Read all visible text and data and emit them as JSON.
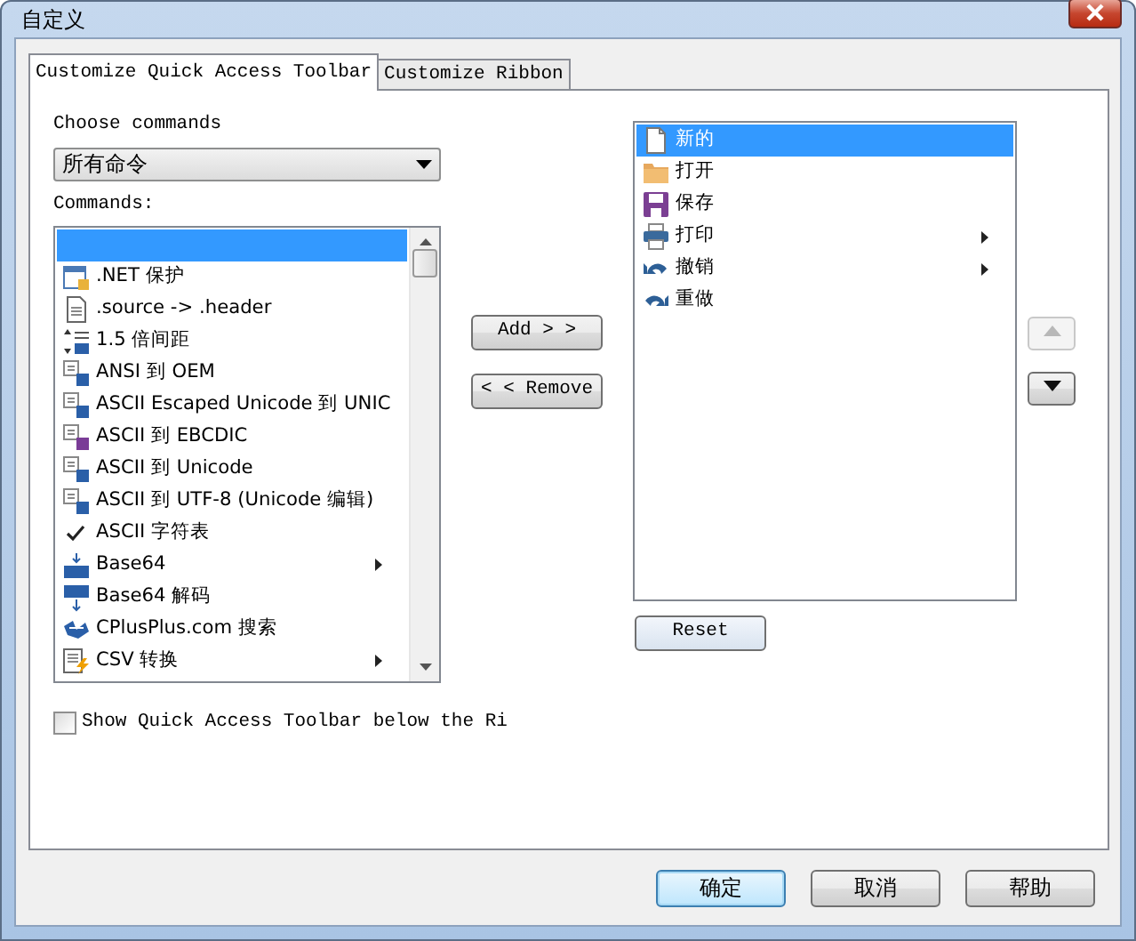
{
  "window": {
    "title": "自定义"
  },
  "tabs": [
    {
      "label": "Customize Quick Access Toolbar",
      "selected": true
    },
    {
      "label": "Customize Ribbon",
      "selected": false
    }
  ],
  "choose_label": "Choose commands",
  "command_dropdown": {
    "value": "所有命令"
  },
  "commands_label": "Commands:",
  "commands": [
    {
      "selected": true,
      "checked": false,
      "has_submenu": false
    },
    {
      "label": ".NET 保护",
      "selected": false,
      "checked": false,
      "has_submenu": false
    },
    {
      "label": ".source -> .header",
      "selected": false,
      "checked": false,
      "has_submenu": false
    },
    {
      "label": "1.5 倍间距",
      "selected": false,
      "checked": false,
      "has_submenu": false
    },
    {
      "label": "ANSI 到 OEM",
      "selected": false,
      "checked": false,
      "has_submenu": false
    },
    {
      "label": "ASCII Escaped Unicode 到 UNIC",
      "selected": false,
      "checked": false,
      "has_submenu": false
    },
    {
      "label": "ASCII 到 EBCDIC",
      "selected": false,
      "checked": false,
      "has_submenu": false
    },
    {
      "label": "ASCII 到 Unicode",
      "selected": false,
      "checked": false,
      "has_submenu": false
    },
    {
      "label": "ASCII 到 UTF-8 (Unicode 编辑)",
      "selected": false,
      "checked": false,
      "has_submenu": false
    },
    {
      "label": "ASCII 字符表",
      "selected": false,
      "checked": true,
      "has_submenu": false
    },
    {
      "label": "Base64",
      "selected": false,
      "checked": false,
      "has_submenu": true
    },
    {
      "label": "Base64 解码",
      "selected": false,
      "checked": false,
      "has_submenu": false
    },
    {
      "label": "CPlusPlus.com 搜索",
      "selected": false,
      "checked": false,
      "has_submenu": false
    },
    {
      "label": "CSV 转换",
      "selected": false,
      "checked": false,
      "has_submenu": true
    }
  ],
  "add_button": "Add > >",
  "remove_button": "< < Remove",
  "toolbar_items": [
    {
      "label": "新的",
      "selected": true,
      "has_submenu": false
    },
    {
      "label": "打开",
      "selected": false,
      "has_submenu": false
    },
    {
      "label": "保存",
      "selected": false,
      "has_submenu": false
    },
    {
      "label": "打印",
      "selected": false,
      "has_submenu": true
    },
    {
      "label": "撤销",
      "selected": false,
      "has_submenu": true
    },
    {
      "label": "重做",
      "selected": false,
      "has_submenu": false
    }
  ],
  "reset_button": "Reset",
  "move_up": {
    "disabled": true
  },
  "move_down": {
    "disabled": false
  },
  "below_ribbon": {
    "label": "Show Quick Access Toolbar below the Ri",
    "checked": false
  },
  "footer_buttons": [
    {
      "label": "确定",
      "default": true
    },
    {
      "label": "取消",
      "default": false
    },
    {
      "label": "帮助",
      "default": false
    }
  ]
}
